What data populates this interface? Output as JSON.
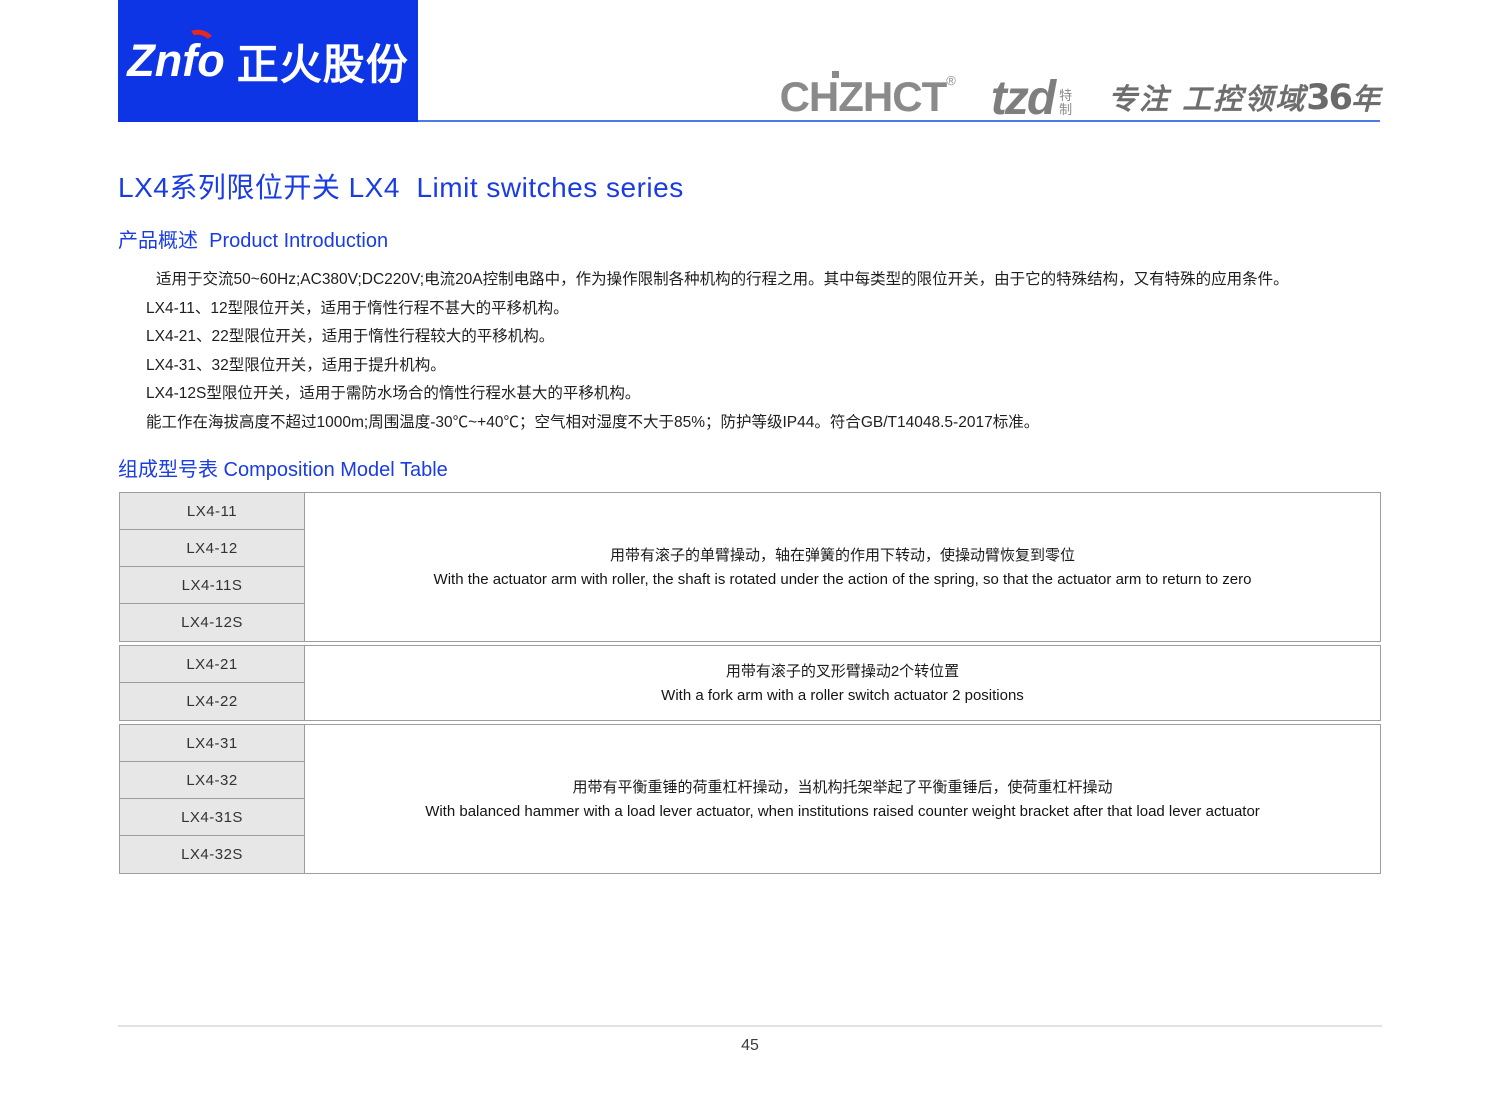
{
  "header": {
    "logo_left": {
      "brand": "Znfo",
      "company": "正火股份"
    },
    "logo_right": {
      "chzhct_part1": "CH",
      "chzhct_z": "Z",
      "chzhct_part2": "HCT",
      "reg_mark": "®",
      "tzd": "tzd",
      "tzd_sub_top": "特",
      "tzd_sub_bottom": "制",
      "slogan_prefix": "专注 工控领域",
      "slogan_number": "36",
      "slogan_suffix": "年"
    }
  },
  "title": "LX4系列限位开关 LX4  Limit switches series",
  "sections": {
    "intro_heading": "产品概述  Product Introduction",
    "intro_lines": [
      "适用于交流50~60Hz;AC380V;DC220V;电流20A控制电路中，作为操作限制各种机构的行程之用。其中每类型的限位开关，由于它的特殊结构，又有特殊的应用条件。",
      "LX4-11、12型限位开关，适用于惰性行程不甚大的平移机构。",
      "LX4-21、22型限位开关，适用于惰性行程较大的平移机构。",
      "LX4-31、32型限位开关，适用于提升机构。",
      "LX4-12S型限位开关，适用于需防水场合的惰性行程水甚大的平移机构。",
      "能工作在海拔高度不超过1000m;周围温度-30℃~+40℃；空气相对湿度不大于85%；防护等级IP44。符合GB/T14048.5-2017标准。"
    ],
    "table_heading": "组成型号表 Composition Model Table"
  },
  "table": {
    "groups": [
      {
        "models": [
          "LX4-11",
          "LX4-12",
          "LX4-11S",
          "LX4-12S"
        ],
        "desc_zh": "用带有滚子的单臂操动，轴在弹簧的作用下转动，使操动臂恢复到零位",
        "desc_en": "With the actuator arm with roller, the shaft is rotated under the action of the spring, so that the actuator arm to return to zero"
      },
      {
        "models": [
          "LX4-21",
          "LX4-22"
        ],
        "desc_zh": "用带有滚子的叉形臂操动2个转位置",
        "desc_en": "With a fork arm with a roller switch actuator 2 positions"
      },
      {
        "models": [
          "LX4-31",
          "LX4-32",
          "LX4-31S",
          "LX4-32S"
        ],
        "desc_zh": "用带有平衡重锤的荷重杠杆操动，当机构托架举起了平衡重锤后，使荷重杠杆操动",
        "desc_en": "With balanced hammer with a load lever actuator, when institutions raised counter weight bracket after that load lever actuator"
      }
    ]
  },
  "footer": {
    "page_number": "45"
  },
  "colors": {
    "brand_blue": "#0d35e6",
    "heading_blue": "#1a3ce3",
    "header_line_blue": "#4a7ce8",
    "flame_red": "#e8281e",
    "logo_gray": "#8a8a8a",
    "table_cell_gray": "#e7e7e7",
    "table_border_gray": "#9d9d9d"
  }
}
